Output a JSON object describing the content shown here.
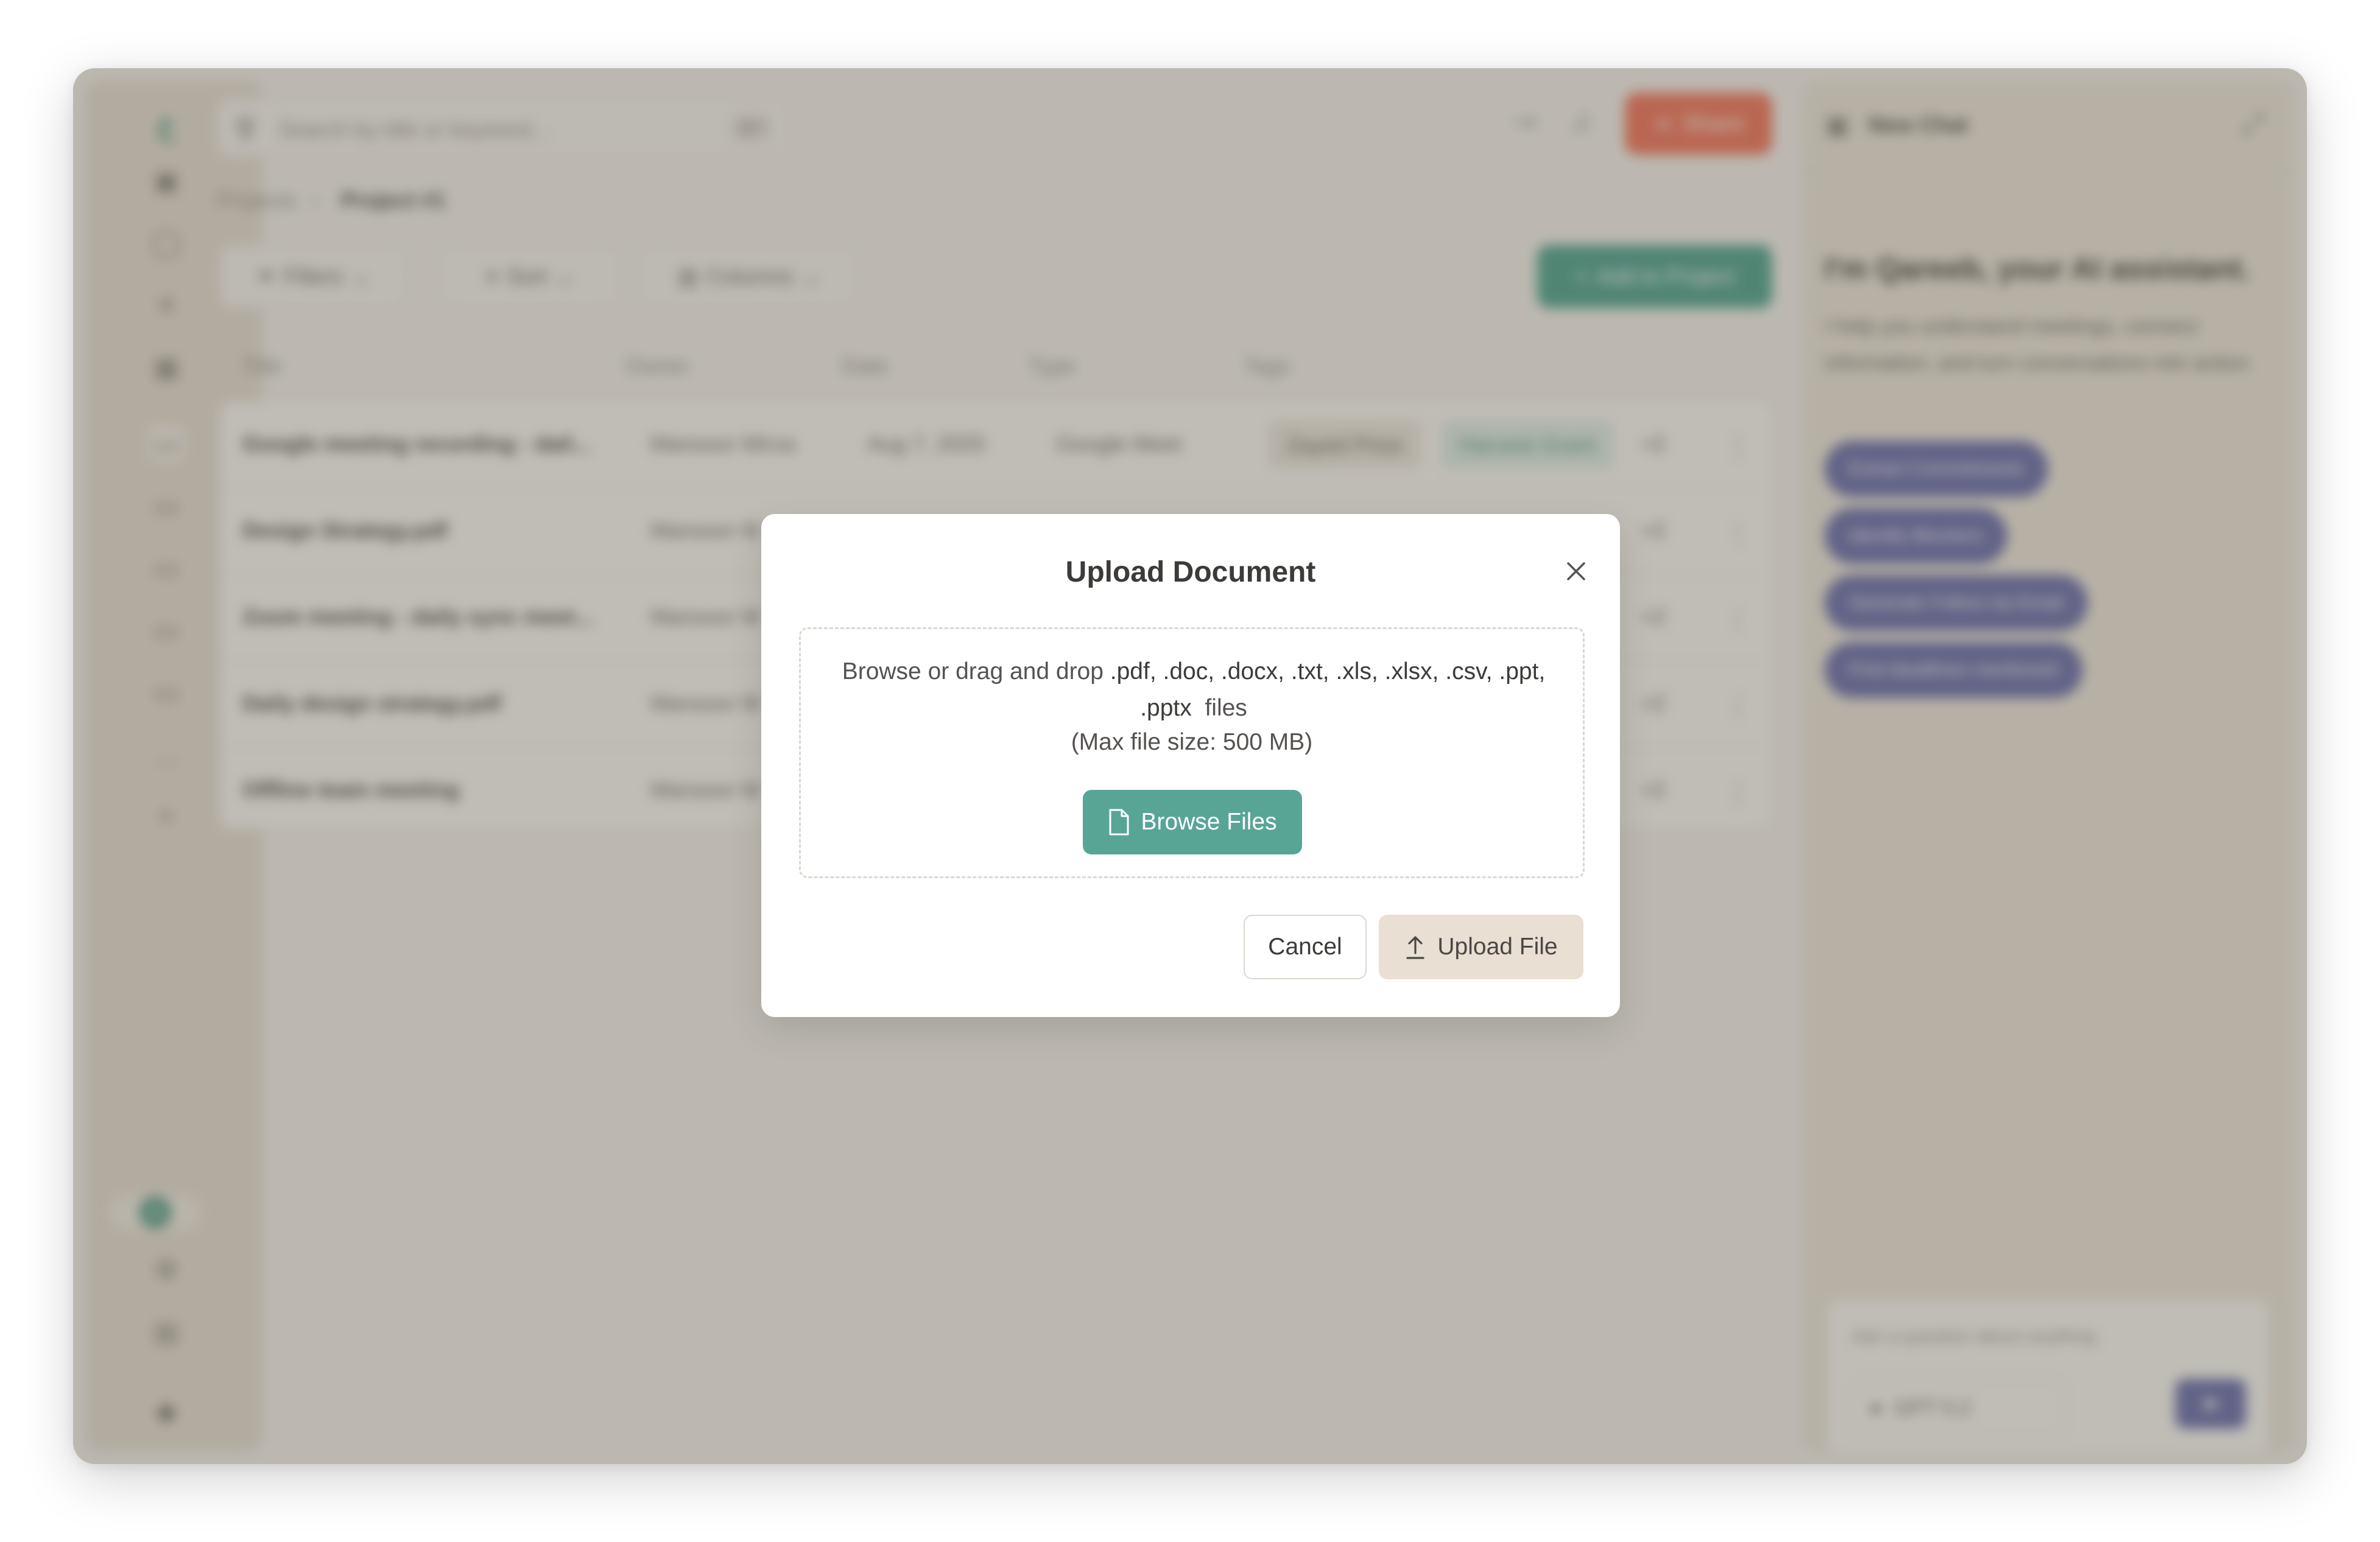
{
  "search": {
    "placeholder": "Search by title or keyword...",
    "shortcut": "⌘F"
  },
  "topbar": {
    "share_label": "Share"
  },
  "breadcrumb": {
    "root": "Projects",
    "current": "Project #1"
  },
  "toolbar": {
    "filters_label": "Filters",
    "sort_label": "Sort",
    "columns_label": "Columns",
    "add_label": "Add to Project"
  },
  "table": {
    "headers": [
      "Title",
      "Owner",
      "Date",
      "Type",
      "Tags"
    ],
    "rows": [
      {
        "title": "Google meeting recording - dail...",
        "owner": "Mansoor Mirza",
        "date": "Aug 7, 2025",
        "type": "Google Meet",
        "tag1": "Zayed Price",
        "tag2": "Harvest Grant",
        "more": "+2"
      },
      {
        "title": "Design Strategy.pdf",
        "owner": "Mansoor M",
        "date": "",
        "type": "",
        "tag1": "",
        "tag2": "",
        "more": "+2"
      },
      {
        "title": "Zoom meeting - daily sync meet...",
        "owner": "Mansoor M",
        "date": "",
        "type": "",
        "tag1": "",
        "tag2": "",
        "more": "+2"
      },
      {
        "title": "Daily design strategy.pdf",
        "owner": "Mansoor M",
        "date": "",
        "type": "",
        "tag1": "",
        "tag2": "",
        "more": "+2"
      },
      {
        "title": "Offline team meeting",
        "owner": "Mansoor M",
        "date": "",
        "type": "",
        "tag1": "",
        "tag2": "",
        "more": "+2"
      }
    ]
  },
  "chat": {
    "title": "New Chat",
    "heading": "I'm Qareeb, your AI assistant.",
    "intro": "I help you understand meetings, connect information, and turn conversations into action.",
    "chips": [
      "Extract Commitments",
      "Identify Blockers",
      "Generate Follow-Up Email",
      "Find deadlines mentioned"
    ],
    "input_placeholder": "Ask a question about anything",
    "model": "GPT 5.2"
  },
  "sidebar": {
    "brand_glyph": "ع",
    "avatar_letter": "A"
  },
  "modal": {
    "title": "Upload Document",
    "prompt_prefix": "Browse or drag and drop",
    "extensions": ".pdf, .doc, .docx, .txt, .xls, .xlsx, .csv, .ppt, .pptx",
    "prompt_suffix": "files",
    "max_size": "(Max file size: 500 MB)",
    "browse_label": "Browse Files",
    "cancel_label": "Cancel",
    "upload_label": "Upload File"
  },
  "colors": {
    "accent": "#58a596",
    "share": "#f0664a",
    "chip": "#5a5fa6",
    "upload_button": "#e9dfd2"
  },
  "icons": [
    "search-icon",
    "share-icon",
    "bell-icon",
    "pin-icon",
    "filter-icon",
    "sort-icon",
    "columns-icon",
    "plus-icon",
    "close-icon",
    "file-icon",
    "upload-icon",
    "send-icon",
    "folder-icon",
    "kebab-icon"
  ]
}
